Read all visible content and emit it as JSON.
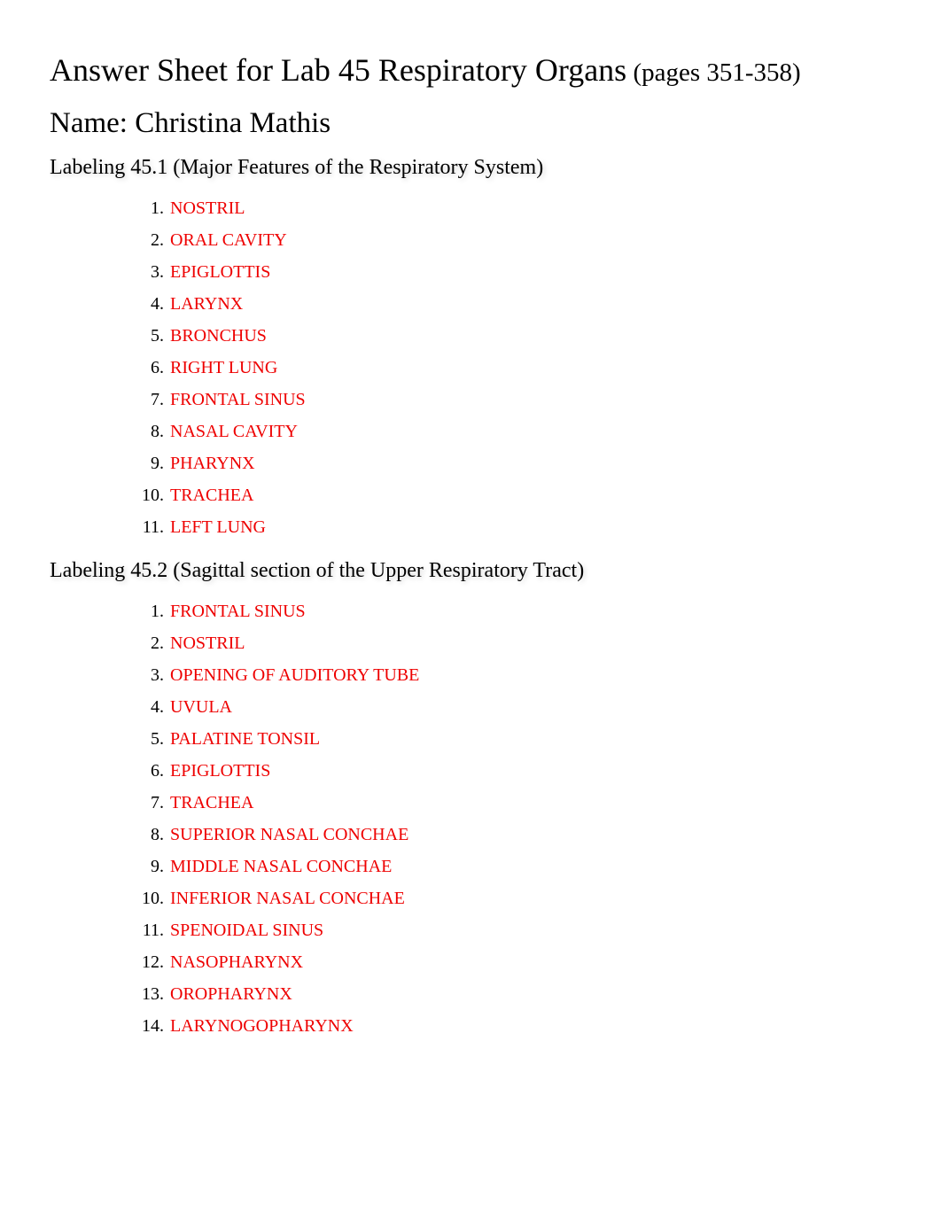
{
  "header": {
    "title_main": "Answer Sheet for Lab 45 Respiratory Organs",
    "title_pages": " (pages 351-358)",
    "name_label": "Name: ",
    "name_value": "Christina Mathis"
  },
  "sections": [
    {
      "heading": "Labeling 45.1 (Major Features of the Respiratory System)",
      "items": [
        "NOSTRIL",
        "ORAL CAVITY",
        "EPIGLOTTIS",
        "LARYNX",
        "BRONCHUS",
        "RIGHT LUNG",
        "FRONTAL SINUS",
        "NASAL CAVITY",
        "PHARYNX",
        "TRACHEA",
        "LEFT LUNG"
      ]
    },
    {
      "heading": "Labeling 45.2 (Sagittal section of the Upper Respiratory Tract)",
      "items": [
        "FRONTAL SINUS",
        "NOSTRIL",
        "OPENING OF AUDITORY TUBE",
        "UVULA",
        "PALATINE TONSIL",
        "EPIGLOTTIS",
        "TRACHEA",
        "SUPERIOR NASAL CONCHAE",
        "MIDDLE NASAL CONCHAE",
        "INFERIOR NASAL CONCHAE",
        "SPENOIDAL SINUS",
        "NASOPHARYNX",
        "OROPHARYNX",
        "LARYNOGOPHARYNX"
      ]
    }
  ]
}
